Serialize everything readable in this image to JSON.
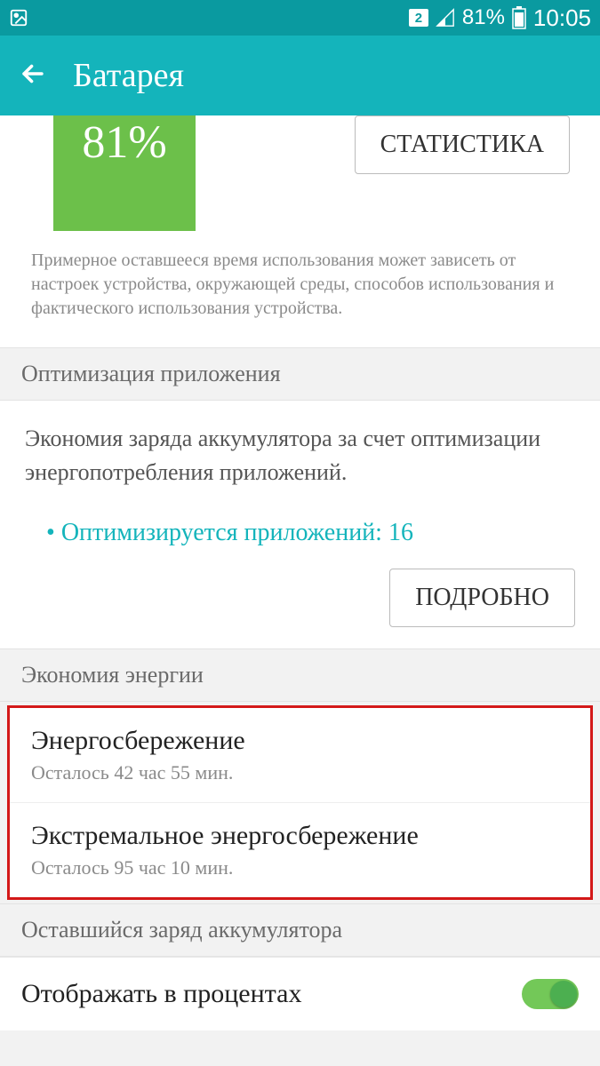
{
  "statusbar": {
    "sim_slot": "2",
    "battery_percent": "81%",
    "time": "10:05"
  },
  "appbar": {
    "title": "Батарея"
  },
  "battery": {
    "level_text": "81%",
    "stats_button": "СТАТИСТИКА",
    "disclaimer": "Примерное оставшееся время использования может зависеть от настроек устройства, окружающей среды, способов использования и фактического использования устройства."
  },
  "sections": {
    "optimization_header": "Оптимизация приложения",
    "optimization_desc": "Экономия заряда аккумулятора за счет оптимизации энергопотребления приложений.",
    "optimization_count": "Оптимизируется приложений: 16",
    "details_button": "ПОДРОБНО",
    "power_saving_header": "Экономия энергии",
    "remaining_header": "Оставшийся заряд аккумулятора"
  },
  "power_modes": [
    {
      "title": "Энергосбережение",
      "sub": "Осталось 42 час 55 мин."
    },
    {
      "title": "Экстремальное энергосбережение",
      "sub": "Осталось 95 час 10 мин."
    }
  ],
  "percent_toggle": {
    "label": "Отображать в процентах",
    "on": true
  }
}
